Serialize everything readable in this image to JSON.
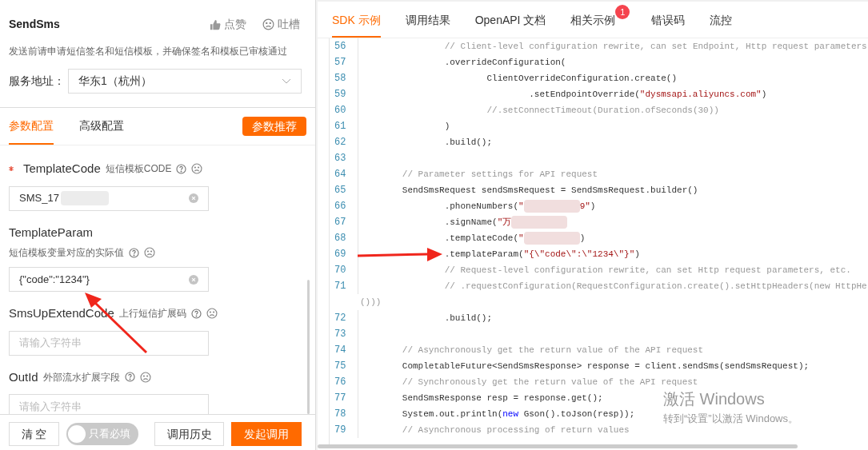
{
  "left": {
    "title": "SendSms",
    "actions": [
      {
        "kind": "like",
        "label": "点赞"
      },
      {
        "kind": "complain",
        "label": "吐槽"
      }
    ],
    "notice": "发送前请申请短信签名和短信模板，并确保签名和模板已审核通过",
    "service": {
      "label": "服务地址：",
      "value": "华东1（杭州）"
    },
    "tabs": [
      {
        "label": "参数配置",
        "selected": true
      },
      {
        "label": "高级配置",
        "selected": false
      }
    ],
    "recommend_button": "参数推荐",
    "params": [
      {
        "name": "TemplateCode",
        "required": true,
        "kind": "inline",
        "description": "短信模板CODE",
        "value": "SMS_17",
        "redacted": true
      },
      {
        "name": "TemplateParam",
        "required": false,
        "kind": "stacked",
        "description": "短信模板变量对应的实际值",
        "value": "{\"code\":\"1234\"}",
        "redacted": false
      },
      {
        "name": "SmsUpExtendCode",
        "required": false,
        "kind": "inline",
        "description": "上行短信扩展码",
        "placeholder": "请输入字符串",
        "redacted": false
      },
      {
        "name": "OutId",
        "required": false,
        "kind": "inline",
        "description": "外部流水扩展字段",
        "placeholder": "请输入字符串",
        "redacted": false
      }
    ],
    "footer": {
      "clear_button": "清 空",
      "toggle": {
        "label": "只看必填",
        "on": false
      },
      "history_button": "调用历史",
      "submit_button": "发起调用"
    }
  },
  "right": {
    "tabs": [
      {
        "label": "SDK 示例",
        "selected": true
      },
      {
        "label": "调用结果",
        "selected": false
      },
      {
        "label": "OpenAPI 文档",
        "selected": false
      },
      {
        "label": "相关示例",
        "selected": false,
        "badge": "1"
      },
      {
        "label": "错误码",
        "selected": false
      },
      {
        "label": "流控",
        "selected": false
      }
    ],
    "code_lines": [
      {
        "number": "56",
        "segments": [
          {
            "kind": "comment",
            "text": "                // Client-level configuration rewrite, can set Endpoint, Http request parameters"
          }
        ]
      },
      {
        "number": "57",
        "segments": [
          {
            "kind": "plain",
            "text": "                .overrideConfiguration("
          }
        ]
      },
      {
        "number": "58",
        "segments": [
          {
            "kind": "plain",
            "text": "                        ClientOverrideConfiguration.create()"
          }
        ]
      },
      {
        "number": "59",
        "segments": [
          {
            "kind": "plain",
            "text": "                                .setEndpointOverride("
          },
          {
            "kind": "string",
            "text": "\"dysmsapi.aliyuncs.com\""
          },
          {
            "kind": "plain",
            "text": ")"
          }
        ]
      },
      {
        "number": "60",
        "segments": [
          {
            "kind": "comment",
            "text": "                        //.setConnectTimeout(Duration.ofSeconds(30))"
          }
        ]
      },
      {
        "number": "61",
        "segments": [
          {
            "kind": "plain",
            "text": "                )"
          }
        ]
      },
      {
        "number": "62",
        "segments": [
          {
            "kind": "plain",
            "text": "                .build();"
          }
        ]
      },
      {
        "number": "63"
      },
      {
        "number": "64",
        "segments": [
          {
            "kind": "comment",
            "text": "        // Parameter settings for API request"
          }
        ]
      },
      {
        "number": "65",
        "segments": [
          {
            "kind": "plain",
            "text": "        SendSmsRequest sendSmsRequest = SendSmsRequest.builder()"
          }
        ]
      },
      {
        "number": "66",
        "segments": [
          {
            "kind": "plain",
            "text": "                .phoneNumbers("
          },
          {
            "kind": "string",
            "text": "\""
          },
          {
            "kind": "blur"
          },
          {
            "kind": "string",
            "text": "9\""
          },
          {
            "kind": "plain",
            "text": ")"
          }
        ]
      },
      {
        "number": "67",
        "segments": [
          {
            "kind": "plain",
            "text": "                .signName("
          },
          {
            "kind": "string",
            "text": "\"万"
          },
          {
            "kind": "blur"
          }
        ]
      },
      {
        "number": "68",
        "segments": [
          {
            "kind": "plain",
            "text": "                .templateCode("
          },
          {
            "kind": "string",
            "text": "\""
          },
          {
            "kind": "blur"
          },
          {
            "kind": "plain",
            "text": ")"
          }
        ]
      },
      {
        "number": "69",
        "segments": [
          {
            "kind": "plain",
            "text": "                .templateParam("
          },
          {
            "kind": "string",
            "text": "\"{\\\"code\\\":\\\"1234\\\"}\""
          },
          {
            "kind": "plain",
            "text": ")"
          }
        ]
      },
      {
        "number": "70",
        "segments": [
          {
            "kind": "comment",
            "text": "                // Request-level configuration rewrite, can set Http request parameters, etc."
          }
        ]
      },
      {
        "number": "71",
        "segments": [
          {
            "kind": "comment",
            "text": "                // .requestConfiguration(RequestConfiguration.create().setHttpHeaders(new HttpHe"
          }
        ],
        "continuation": "()))"
      },
      {
        "number": "72",
        "segments": [
          {
            "kind": "plain",
            "text": "                .build();"
          }
        ]
      },
      {
        "number": "73"
      },
      {
        "number": "74",
        "segments": [
          {
            "kind": "comment",
            "text": "        // Asynchronously get the return value of the API request"
          }
        ]
      },
      {
        "number": "75",
        "segments": [
          {
            "kind": "plain",
            "text": "        CompletableFuture<SendSmsResponse> response = client.sendSms(sendSmsRequest);"
          }
        ]
      },
      {
        "number": "76",
        "segments": [
          {
            "kind": "comment",
            "text": "        // Synchronously get the return value of the API request"
          }
        ]
      },
      {
        "number": "77",
        "segments": [
          {
            "kind": "plain",
            "text": "        SendSmsResponse resp = response.get();"
          }
        ]
      },
      {
        "number": "78",
        "segments": [
          {
            "kind": "plain",
            "text": "        System.out.println("
          },
          {
            "kind": "keyword",
            "text": "new"
          },
          {
            "kind": "plain",
            "text": " Gson().toJson(resp));"
          }
        ]
      },
      {
        "number": "79",
        "segments": [
          {
            "kind": "comment",
            "text": "        // Asynchronous processing of return values"
          }
        ]
      }
    ]
  },
  "os_notice": {
    "title": "激活 Windows",
    "text": "转到“设置”以激活 Windows。"
  }
}
